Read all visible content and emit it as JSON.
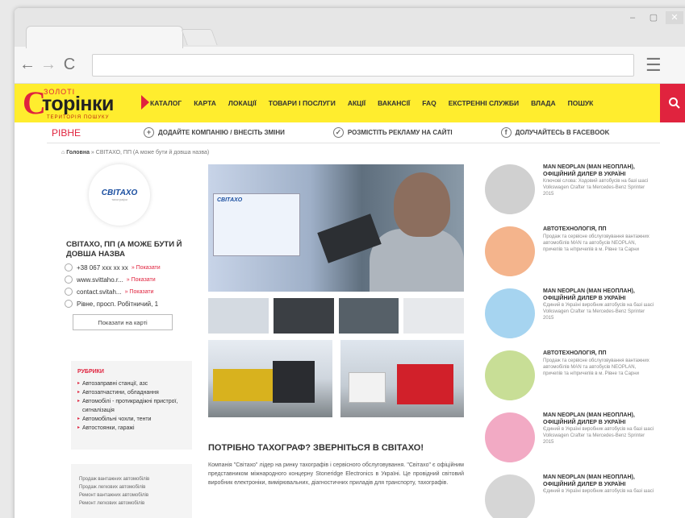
{
  "browser": {
    "window_controls": [
      "–",
      "▢",
      "✕"
    ],
    "back": "←",
    "forward": "→",
    "reload": "C",
    "menu": "☰"
  },
  "site": {
    "logo_top": "ЗОЛОТІ",
    "logo_c": "С",
    "logo_main": "торінки",
    "logo_sub": "ТЕРИТОРІЯ ПОШУКУ",
    "accent": "#e0233e",
    "yellow": "#ffed2e"
  },
  "nav": [
    "КАТАЛОГ",
    "КАРТА",
    "ЛОКАЦІЇ",
    "ТОВАРИ І ПОСЛУГИ",
    "АКЦІЇ",
    "ВАКАНСІЇ",
    "FAQ",
    "ЕКСТРЕННІ СЛУЖБИ",
    "ВЛАДА",
    "ПОШУК"
  ],
  "subbar": {
    "city": "РІВНЕ",
    "links": [
      {
        "icon": "+",
        "label": "ДОДАЙТЕ КОМПАНІЮ / ВНЕСІТЬ ЗМІНИ"
      },
      {
        "icon": "✓",
        "label": "РОЗМІСТІТЬ РЕКЛАМУ НА САЙТІ"
      },
      {
        "icon": "f",
        "label": "ДОЛУЧАЙТЕСЬ В FACEBOOK"
      }
    ]
  },
  "breadcrumb": {
    "home": "Головна",
    "current": "» СВІТАХО, ПП (А може бути й довша назва)"
  },
  "company": {
    "logo_name": "СВІТАХО",
    "logo_tag": "тахографи",
    "name": "СВІТАХО, ПП (А МОЖЕ БУТИ Й ДОВША НАЗВА",
    "phone": "+38 067 ххх хх хх",
    "site": "www.svittaho.r...",
    "email": "contact.svitah...",
    "address": "Рівне, просп. Робітничий, 1",
    "show": "» Показати",
    "map_button": "Показати на карті"
  },
  "rubrics": {
    "title": "РУБРИКИ",
    "items": [
      "Автозаправні станції, азс",
      "Автозапчастини, обладнання",
      "Автомобілі - протикрадіжні пристрої, сигналізація",
      "Автомобільні чохли, тенти",
      "Автостоянки, гаражі"
    ]
  },
  "greybox": [
    "Продаж вантажних автомобілів",
    "Продаж легкових автомобілів",
    "Ремонт вантажних автомобілів",
    "Ремонт легкових автомобілів"
  ],
  "main_image_label": "СВІТАХО",
  "article": {
    "headline": "ПОТРІБНО ТАХОГРАФ? ЗВЕРНІТЬСЯ В СВІТАХО!",
    "body": "Компанія \"Світахо\" лідер на ринку тахографів і сервісного обслуговування. \"Світахо\" є офіційним представником міжнародного концерну Stoneridge Electronics в Україні. Це провідний світовий виробник електроніки, вимірювальних, діагностичних приладів для транспорту, тахографів."
  },
  "right_items": [
    {
      "color": "#d0d0d0",
      "title": "MAN NEOPLAN (MAN НЕОПЛАН), ОФІЦІЙНИЙ ДИЛЕР В УКРАЇНІ",
      "desc": "Ключові слова: Ходовий автобусів на базі шасі Volkswagen Crafter та Mercedes-Benz Sprinter 2015"
    },
    {
      "color": "#f4b48c",
      "title": "АВТОТЕХНОЛОГІЯ, ПП",
      "desc": "Продаж та сервісне обслуговування вантажних автомобілів MAN та автобусів NEOPLAN, причепів та н/причепів в м. Рівне та Сарни"
    },
    {
      "color": "#a6d4f0",
      "title": "MAN NEOPLAN (MAN НЕОПЛАН), ОФІЦІЙНИЙ ДИЛЕР В УКРАЇНІ",
      "desc": "Єдиний в Україні виробник автобусів на базі шасі Volkswagen Crafter та Mercedes-Benz Sprinter 2015"
    },
    {
      "color": "#c8de96",
      "title": "АВТОТЕХНОЛОГІЯ, ПП",
      "desc": "Продаж та сервісне обслуговування вантажних автомобілів MAN та автобусів NEOPLAN, причепів та н/причепів в м. Рівне та Сарни"
    },
    {
      "color": "#f2aac4",
      "title": "MAN NEOPLAN (MAN НЕОПЛАН), ОФІЦІЙНИЙ ДИЛЕР В УКРАЇНІ",
      "desc": "Єдиний в Україні виробник автобусів на базі шасі Volkswagen Crafter та Mercedes-Benz Sprinter 2015"
    },
    {
      "color": "#d6d6d6",
      "title": "MAN NEOPLAN (MAN НЕОПЛАН), ОФІЦІЙНИЙ ДИЛЕР В УКРАЇНІ",
      "desc": "Єдиний в Україні виробник автобусів на базі шасі"
    }
  ]
}
